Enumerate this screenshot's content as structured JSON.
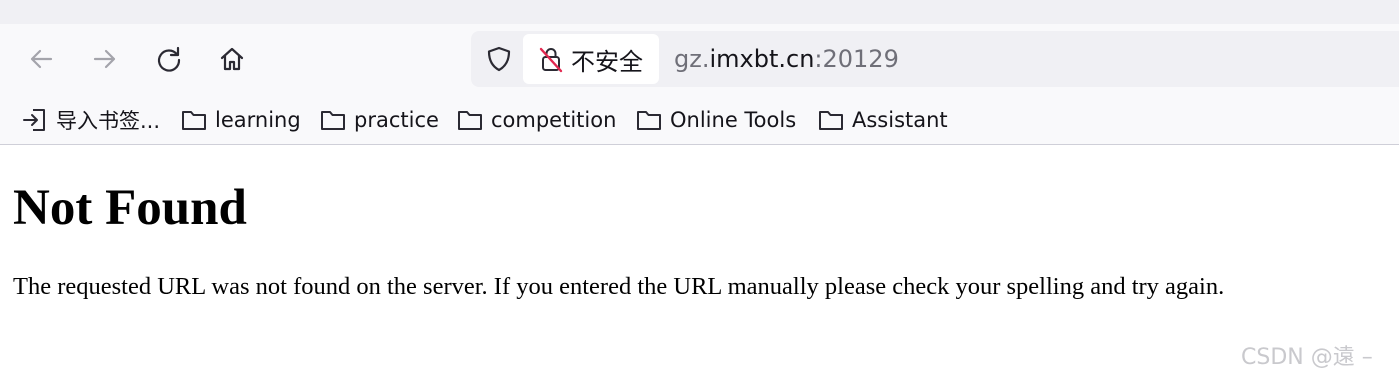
{
  "browser": {
    "security_label": "不安全",
    "url": {
      "prefix": "gz.",
      "host": "imxbt.cn",
      "port": ":20129"
    },
    "icons": {
      "back": "arrow-left-icon",
      "forward": "arrow-right-icon",
      "reload": "reload-icon",
      "home": "home-icon",
      "shield": "shield-icon",
      "insecure": "insecure-lock-icon"
    }
  },
  "bookmarks": [
    {
      "label": "导入书签...",
      "icon": "import-icon"
    },
    {
      "label": "learning",
      "icon": "folder-icon"
    },
    {
      "label": "practice",
      "icon": "folder-icon"
    },
    {
      "label": "competition",
      "icon": "folder-icon"
    },
    {
      "label": "Online Tools",
      "icon": "folder-icon"
    },
    {
      "label": "Assistant",
      "icon": "folder-icon"
    }
  ],
  "page": {
    "heading": "Not Found",
    "message": "The requested URL was not found on the server. If you entered the URL manually please check your spelling and try again."
  },
  "watermark": "CSDN @遠 –"
}
